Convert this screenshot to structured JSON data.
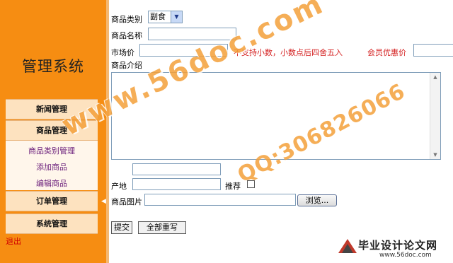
{
  "sidebar": {
    "title": "管理系统",
    "menus": [
      {
        "label": "新闻管理"
      },
      {
        "label": "商品管理"
      },
      {
        "label": "订单管理"
      },
      {
        "label": "系统管理"
      }
    ],
    "sub_items": [
      "商品类别管理",
      "添加商品",
      "编辑商品"
    ],
    "logout": "退出"
  },
  "form": {
    "category_label": "商品类别",
    "category_value": "副食",
    "name_label": "商品名称",
    "price_label": "市场价",
    "price_note": "不支持小数，小数点后四舍五入",
    "member_label": "会员优惠价",
    "intro_label": "商品介绍",
    "origin_label": "产地",
    "recommend_label": "推荐",
    "image_label": "商品图片",
    "browse_label": "浏览...",
    "submit_label": "提交",
    "reset_label": "全部重写"
  },
  "watermark": {
    "site": "www.56doc.com",
    "qq": "QQ:306826066",
    "logo_main": "毕业设计论文网",
    "logo_sub": "www.56doc.com"
  },
  "colors": {
    "sidebar": "#f68d12",
    "menu_bg": "#fde2bf",
    "warning_text": "#d42020",
    "watermark": "#f4a03a"
  }
}
